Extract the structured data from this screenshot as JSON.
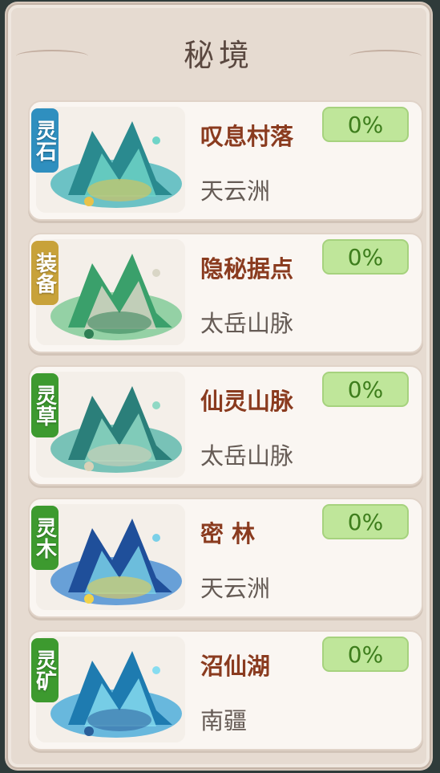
{
  "header": {
    "title": "秘境"
  },
  "realms": [
    {
      "tag": "灵石",
      "tag_color": "#2f8fbf",
      "name": "叹息村落",
      "region": "天云洲",
      "progress": "0%",
      "thumb_icon": "stone-ruins-icon",
      "thumb_palette": [
        "#2a8a8f",
        "#3fb3b8",
        "#6fd4c8",
        "#e9c24a"
      ]
    },
    {
      "tag": "装备",
      "tag_color": "#c8a23a",
      "name": "隐秘据点",
      "region": "太岳山脉",
      "progress": "0%",
      "thumb_icon": "bones-camp-icon",
      "thumb_palette": [
        "#3aa06b",
        "#74c78e",
        "#d9d6c6",
        "#2f7f55"
      ]
    },
    {
      "tag": "灵草",
      "tag_color": "#3d9a2f",
      "name": "仙灵山脉",
      "region": "太岳山脉",
      "progress": "0%",
      "thumb_icon": "mountain-ruins-icon",
      "thumb_palette": [
        "#2b7f7a",
        "#4fb3a6",
        "#8fd8c4",
        "#d8d2b8"
      ]
    },
    {
      "tag": "灵木",
      "tag_color": "#3d9a2f",
      "name": "密  林",
      "region": "天云洲",
      "progress": "0%",
      "thumb_icon": "forest-icon",
      "thumb_palette": [
        "#1f4f9a",
        "#3a86d0",
        "#7ad0e8",
        "#f0d24a"
      ]
    },
    {
      "tag": "灵矿",
      "tag_color": "#3d9a2f",
      "name": "沼仙湖",
      "region": "南疆",
      "progress": "0%",
      "thumb_icon": "vortex-lake-icon",
      "thumb_palette": [
        "#1e7bb0",
        "#39a6d8",
        "#86dcf0",
        "#2a5f9a"
      ]
    }
  ]
}
